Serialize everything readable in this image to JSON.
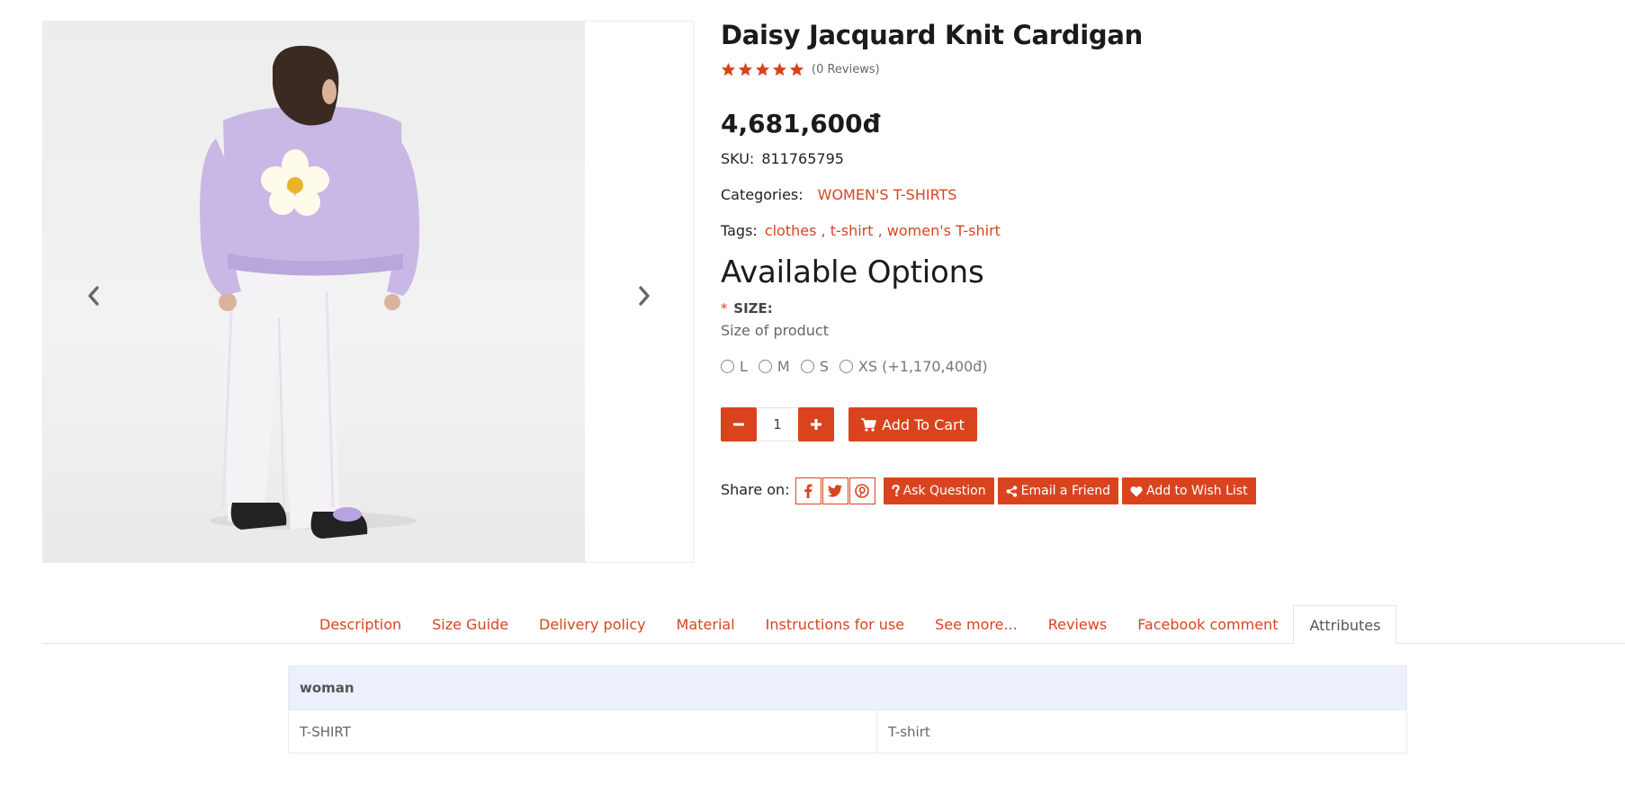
{
  "product": {
    "title": "Daisy Jacquard Knit Cardigan",
    "rating_stars": 5,
    "reviews_text": "(0 Reviews)",
    "price": "4,681,600đ",
    "sku_label": "SKU:",
    "sku_value": "811765795",
    "categories_label": "Categories:",
    "category": "WOMEN'S T-SHIRTS",
    "tags_label": "Tags:",
    "tags": [
      "clothes ,",
      "t-shirt ,",
      "women's T-shirt"
    ]
  },
  "options": {
    "heading": "Available Options",
    "required_mark": "*",
    "size_label": "SIZE:",
    "size_help": "Size of product",
    "sizes": [
      "L",
      "M",
      "S",
      "XS (+1,170,400đ)"
    ]
  },
  "cart": {
    "quantity": "1",
    "add_to_cart_label": "Add To Cart"
  },
  "share": {
    "label": "Share on:",
    "networks": [
      "facebook-icon",
      "twitter-icon",
      "pinterest-icon"
    ],
    "ask_question": "Ask Question",
    "email_friend": "Email a Friend",
    "wish_list": "Add to Wish List"
  },
  "tabs": [
    {
      "label": "Description",
      "active": false
    },
    {
      "label": "Size Guide",
      "active": false
    },
    {
      "label": "Delivery policy",
      "active": false
    },
    {
      "label": "Material",
      "active": false
    },
    {
      "label": "Instructions for use",
      "active": false
    },
    {
      "label": "See more...",
      "active": false
    },
    {
      "label": "Reviews",
      "active": false
    },
    {
      "label": "Facebook comment",
      "active": false
    },
    {
      "label": "Attributes",
      "active": true
    }
  ],
  "attributes": {
    "group": "woman",
    "rows": [
      {
        "name": "T-SHIRT",
        "value": "T-shirt"
      }
    ]
  },
  "colors": {
    "accent": "#d9441e",
    "table_header_bg": "#ecf0fd",
    "sweater": "#c9b8e6"
  }
}
